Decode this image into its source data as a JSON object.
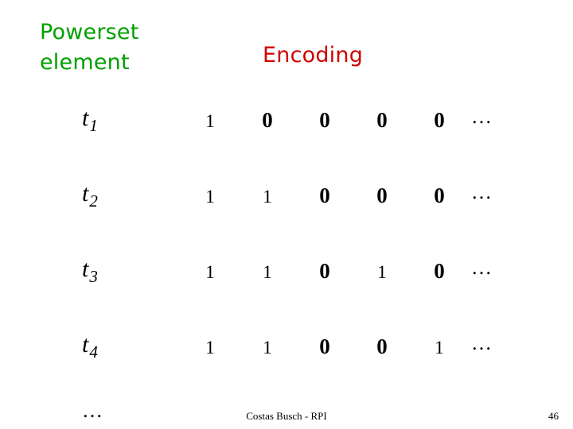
{
  "headings": {
    "powerset": "Powerset\nelement",
    "encoding": "Encoding"
  },
  "colors": {
    "powerset_heading": "#00a000",
    "encoding_heading": "#d00000",
    "text": "#000000",
    "background": "#ffffff"
  },
  "table": {
    "rows": [
      {
        "label": "t",
        "subscript": "1",
        "cells": [
          "1",
          "0",
          "0",
          "0",
          "0"
        ],
        "trailing": "…"
      },
      {
        "label": "t",
        "subscript": "2",
        "cells": [
          "1",
          "1",
          "0",
          "0",
          "0"
        ],
        "trailing": "…"
      },
      {
        "label": "t",
        "subscript": "3",
        "cells": [
          "1",
          "1",
          "0",
          "1",
          "0"
        ],
        "trailing": "…"
      },
      {
        "label": "t",
        "subscript": "4",
        "cells": [
          "1",
          "1",
          "0",
          "0",
          "1"
        ],
        "trailing": "…"
      }
    ],
    "vertical_ellipsis": "…"
  },
  "footer": {
    "credit": "Costas Busch - RPI",
    "page": "46"
  }
}
